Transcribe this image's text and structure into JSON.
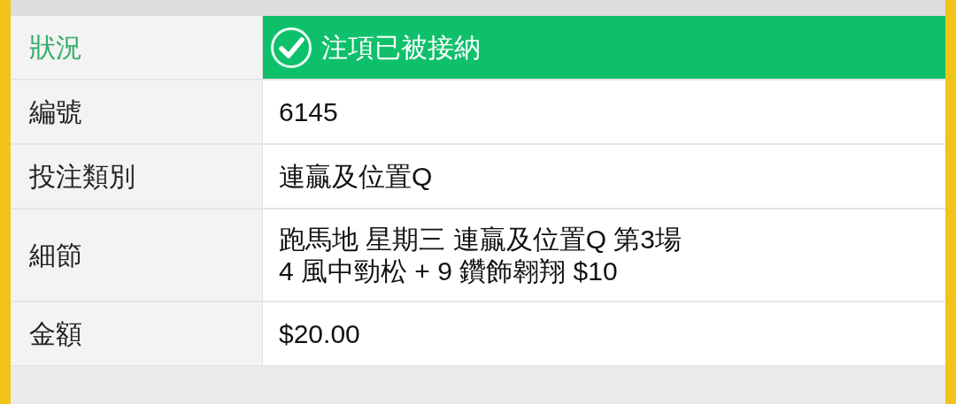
{
  "rows": [
    {
      "kind": "status",
      "label": "狀況",
      "lines": [
        "注項已被接納"
      ]
    },
    {
      "kind": "text",
      "label": "編號",
      "lines": [
        "6145"
      ]
    },
    {
      "kind": "text",
      "label": "投注類別",
      "lines": [
        "連贏及位置Q"
      ]
    },
    {
      "kind": "text",
      "label": "細節",
      "lines": [
        "跑馬地 星期三 連贏及位置Q 第3場",
        "4 風中勁松 + 9 鑽飾翱翔 $10"
      ]
    },
    {
      "kind": "text",
      "label": "金額",
      "lines": [
        "$20.00"
      ]
    }
  ]
}
